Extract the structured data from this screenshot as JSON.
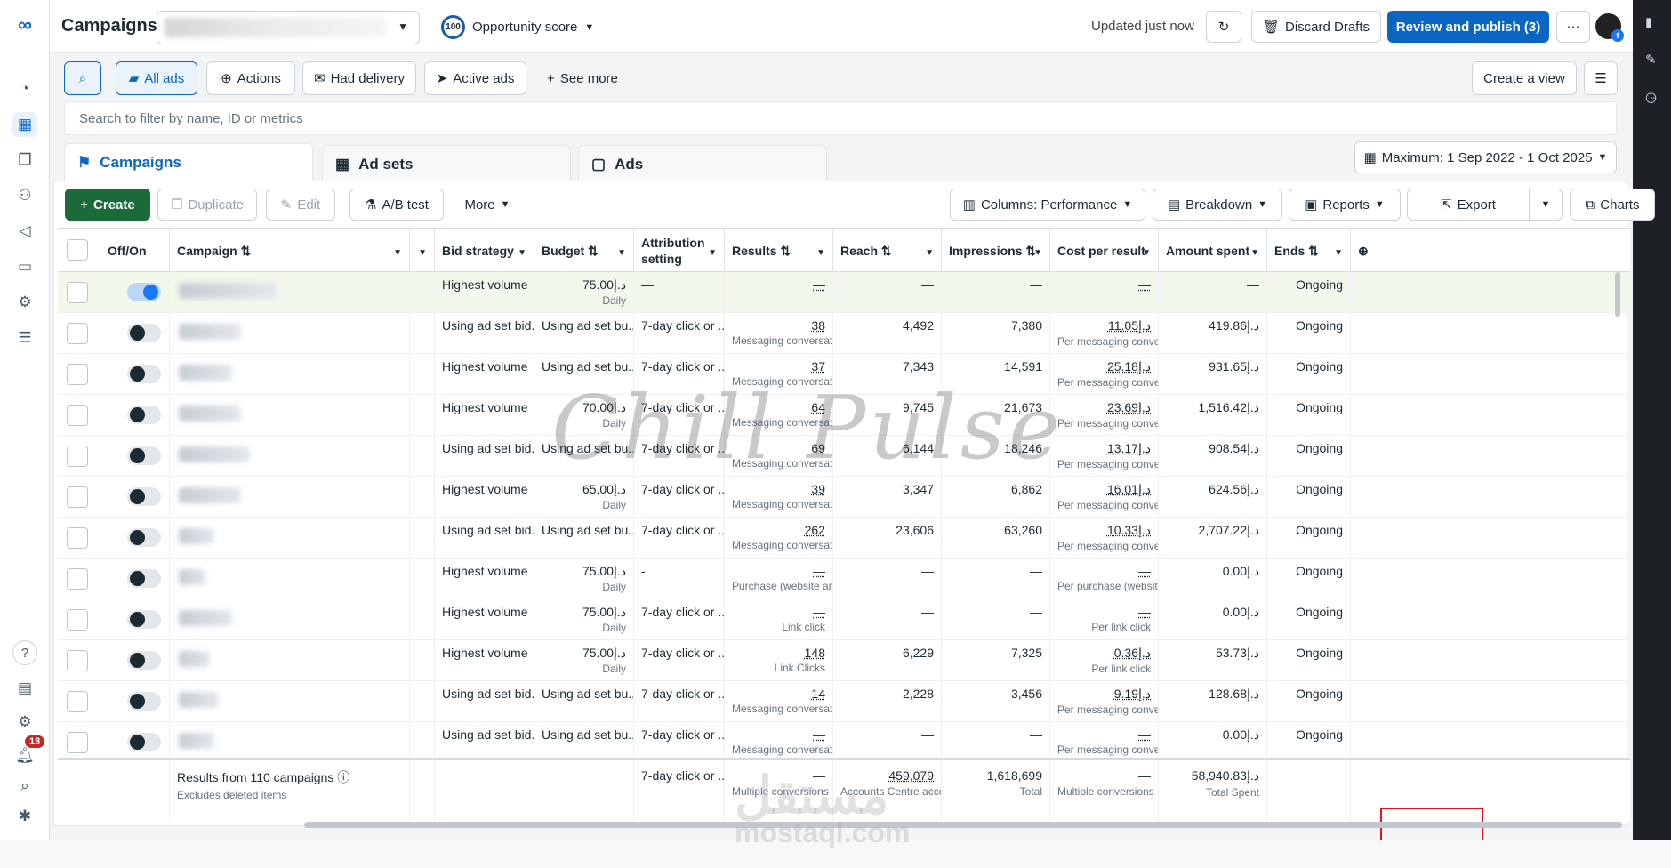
{
  "top": {
    "title": "Campaigns",
    "opportunity_score": "100",
    "opportunity_label": "Opportunity score",
    "updated": "Updated just now",
    "discard": "Discard Drafts",
    "review": "Review and publish (3)",
    "more": "⋯"
  },
  "filters": {
    "all_ads": "All ads",
    "actions": "Actions",
    "had_delivery": "Had delivery",
    "active_ads": "Active ads",
    "see_more": "See more",
    "create_view": "Create a view",
    "search_placeholder": "Search to filter by name, ID or metrics"
  },
  "tabs": {
    "campaigns": "Campaigns",
    "adsets": "Ad sets",
    "ads": "Ads",
    "date_range": "Maximum: 1 Sep 2022 - 1 Oct 2025"
  },
  "toolbar": {
    "create": "Create",
    "duplicate": "Duplicate",
    "edit": "Edit",
    "ab_test": "A/B test",
    "more": "More",
    "columns": "Columns: Performance",
    "breakdown": "Breakdown",
    "reports": "Reports",
    "export": "Export",
    "charts": "Charts"
  },
  "headers": {
    "offon": "Off/On",
    "campaign": "Campaign",
    "bid": "Bid strategy",
    "budget": "Budget",
    "attribution": "Attribution setting",
    "results": "Results",
    "reach": "Reach",
    "impressions": "Impressions",
    "cpr": "Cost per result",
    "spent": "Amount spent",
    "ends": "Ends"
  },
  "rows": [
    {
      "on": true,
      "bid": "Highest volume",
      "budget": "75.00د.إ",
      "budget_sub": "Daily",
      "attr": "—",
      "results": "—",
      "results_sub": "",
      "reach": "—",
      "impr": "—",
      "cpr": "—",
      "cpr_sub": "",
      "spent": "—",
      "ends": "Ongoing"
    },
    {
      "on": false,
      "bid": "Using ad set bid...",
      "budget": "Using ad set bu...",
      "budget_sub": "",
      "attr": "7-day click or ...",
      "results": "38",
      "results_sub": "Messaging conversat...",
      "reach": "4,492",
      "impr": "7,380",
      "cpr": "11.05د.إ",
      "cpr_sub": "Per messaging conve...",
      "spent": "419.86د.إ",
      "ends": "Ongoing"
    },
    {
      "on": false,
      "bid": "Highest volume",
      "budget": "Using ad set bu...",
      "budget_sub": "",
      "attr": "7-day click or ...",
      "results": "37",
      "results_sub": "Messaging conversat...",
      "reach": "7,343",
      "impr": "14,591",
      "cpr": "25.18د.إ",
      "cpr_sub": "Per messaging conve...",
      "spent": "931.65د.إ",
      "ends": "Ongoing"
    },
    {
      "on": false,
      "bid": "Highest volume",
      "budget": "70.00د.إ",
      "budget_sub": "Daily",
      "attr": "7-day click or ...",
      "results": "64",
      "results_sub": "Messaging conversat...",
      "reach": "9,745",
      "impr": "21,673",
      "cpr": "23.69د.إ",
      "cpr_sub": "Per messaging conve...",
      "spent": "1,516.42د.إ",
      "ends": "Ongoing"
    },
    {
      "on": false,
      "bid": "Using ad set bid...",
      "budget": "Using ad set bu...",
      "budget_sub": "",
      "attr": "7-day click or ...",
      "results": "69",
      "results_sub": "Messaging conversat...",
      "reach": "6,144",
      "impr": "18,246",
      "cpr": "13.17د.إ",
      "cpr_sub": "Per messaging conve...",
      "spent": "908.54د.إ",
      "ends": "Ongoing"
    },
    {
      "on": false,
      "bid": "Highest volume",
      "budget": "65.00د.إ",
      "budget_sub": "Daily",
      "attr": "7-day click or ...",
      "results": "39",
      "results_sub": "Messaging conversat...",
      "reach": "3,347",
      "impr": "6,862",
      "cpr": "16.01د.إ",
      "cpr_sub": "Per messaging conve...",
      "spent": "624.56د.إ",
      "ends": "Ongoing"
    },
    {
      "on": false,
      "bid": "Using ad set bid...",
      "budget": "Using ad set bu...",
      "budget_sub": "",
      "attr": "7-day click or ...",
      "results": "262",
      "results_sub": "Messaging conversat...",
      "reach": "23,606",
      "impr": "63,260",
      "cpr": "10.33د.إ",
      "cpr_sub": "Per messaging conve...",
      "spent": "2,707.22د.إ",
      "ends": "Ongoing"
    },
    {
      "on": false,
      "bid": "Highest volume",
      "budget": "75.00د.إ",
      "budget_sub": "Daily",
      "attr": "-",
      "results": "—",
      "results_sub": "Purchase (website an...",
      "reach": "—",
      "impr": "—",
      "cpr": "—",
      "cpr_sub": "Per purchase (websit...",
      "spent": "0.00د.إ",
      "ends": "Ongoing"
    },
    {
      "on": false,
      "bid": "Highest volume",
      "budget": "75.00د.إ",
      "budget_sub": "Daily",
      "attr": "7-day click or ...",
      "results": "—",
      "results_sub": "Link click",
      "reach": "—",
      "impr": "—",
      "cpr": "—",
      "cpr_sub": "Per link click",
      "spent": "0.00د.إ",
      "ends": "Ongoing"
    },
    {
      "on": false,
      "bid": "Highest volume",
      "budget": "75.00د.إ",
      "budget_sub": "Daily",
      "attr": "7-day click or ...",
      "results": "148",
      "results_sub": "Link Clicks",
      "reach": "6,229",
      "impr": "7,325",
      "cpr": "0.36د.إ",
      "cpr_sub": "Per link click",
      "spent": "53.73د.إ",
      "ends": "Ongoing"
    },
    {
      "on": false,
      "bid": "Using ad set bid...",
      "budget": "Using ad set bu...",
      "budget_sub": "",
      "attr": "7-day click or ...",
      "results": "14",
      "results_sub": "Messaging conversat...",
      "reach": "2,228",
      "impr": "3,456",
      "cpr": "9.19د.إ",
      "cpr_sub": "Per messaging conve...",
      "spent": "128.68د.إ",
      "ends": "Ongoing"
    },
    {
      "on": false,
      "bid": "Using ad set bid...",
      "budget": "Using ad set bu...",
      "budget_sub": "",
      "attr": "7-day click or ...",
      "results": "—",
      "results_sub": "Messaging conversati...",
      "reach": "—",
      "impr": "—",
      "cpr": "—",
      "cpr_sub": "Per messaging conver...",
      "spent": "0.00د.إ",
      "ends": "Ongoing"
    }
  ],
  "footer": {
    "label": "Results from 110 campaigns",
    "sub": "Excludes deleted items",
    "attr": "7-day click or ...",
    "results": "—",
    "results_sub": "Multiple conversions",
    "reach": "459,079",
    "reach_sub": "Accounts Centre acco...",
    "impr": "1,618,699",
    "impr_sub": "Total",
    "cpr": "—",
    "cpr_sub": "Multiple conversions",
    "spent": "58,940.83د.إ",
    "spent_sub": "Total Spent"
  },
  "nav": {
    "badge": "18"
  },
  "watermark": {
    "brand": "Chill Pulse",
    "site_ar": "مستقل",
    "site": "mostaql.com"
  }
}
